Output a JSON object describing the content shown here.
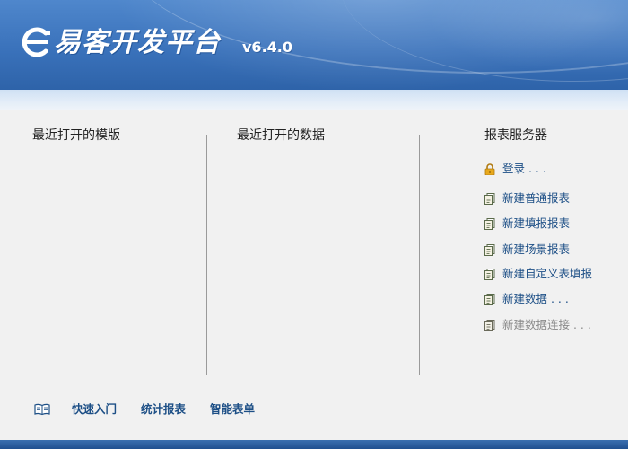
{
  "header": {
    "title": "易客开发平台",
    "version": "v6.4.0",
    "logo_icon": "e-logo-icon",
    "colors": {
      "banner": "#3a72bb",
      "text": "#ffffff"
    }
  },
  "sections": {
    "recent_templates": {
      "title": "最近打开的模版"
    },
    "recent_data": {
      "title": "最近打开的数据"
    },
    "report_server": {
      "title": "报表服务器",
      "items": [
        {
          "label": "登录 . . .",
          "icon": "lock-icon",
          "enabled": true
        },
        {
          "label": "新建普通报表",
          "icon": "document-icon",
          "enabled": true
        },
        {
          "label": "新建填报报表",
          "icon": "document-icon",
          "enabled": true
        },
        {
          "label": "新建场景报表",
          "icon": "document-icon",
          "enabled": true
        },
        {
          "label": "新建自定义表填报",
          "icon": "document-icon",
          "enabled": true
        },
        {
          "label": "新建数据 . . .",
          "icon": "document-icon",
          "enabled": true
        },
        {
          "label": "新建数据连接 . . .",
          "icon": "document-icon",
          "enabled": false
        }
      ]
    }
  },
  "footer": {
    "book_icon": "book-icon",
    "links": [
      "快速入门",
      "统计报表",
      "智能表单"
    ]
  },
  "colors": {
    "link": "#1d4f86",
    "disabled": "#8a8a8a",
    "background": "#f1f1f1"
  }
}
